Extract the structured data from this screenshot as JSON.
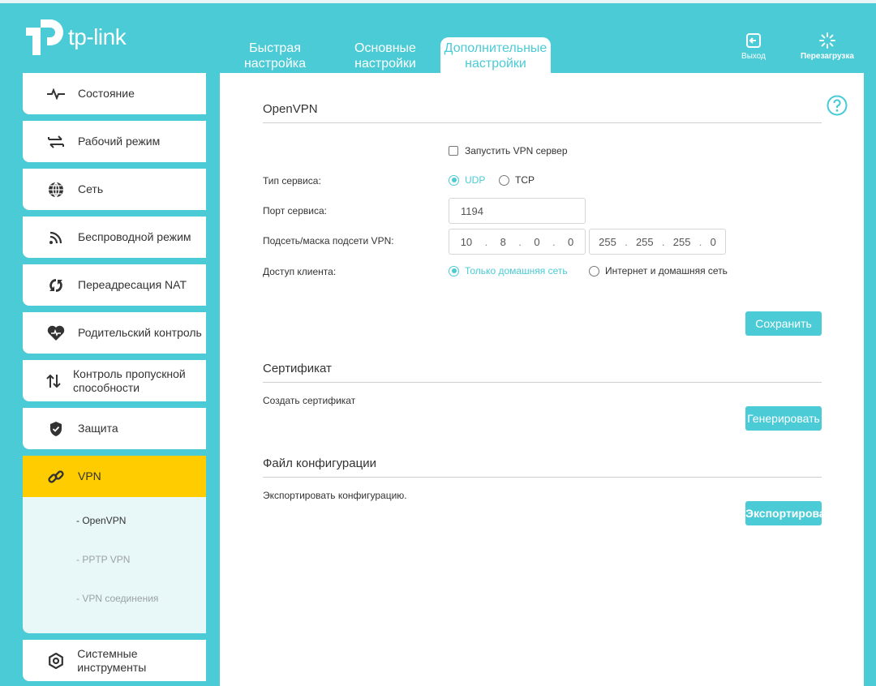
{
  "brand": {
    "logo_text": "tp-link",
    "accent_color": "#4acbd6",
    "active_color": "#ffcc00"
  },
  "header": {
    "tabs": [
      {
        "line1": "Быстрая",
        "line2": "настройка",
        "active": false
      },
      {
        "line1": "Основные",
        "line2": "настройки",
        "active": false
      },
      {
        "line1": "Дополнительные",
        "line2": "настройки",
        "active": true
      }
    ],
    "logout_label": "Выход",
    "reboot_label": "Перезагрузка"
  },
  "sidebar": {
    "items": [
      {
        "label": "Состояние",
        "icon": "pulse-icon"
      },
      {
        "label": "Рабочий режим",
        "icon": "swap-icon"
      },
      {
        "label": "Сеть",
        "icon": "globe-icon"
      },
      {
        "label": "Беспроводной режим",
        "icon": "wifi-icon"
      },
      {
        "label": "Переадресация NAT",
        "icon": "nat-icon"
      },
      {
        "label": "Родительский контроль",
        "icon": "heart-icon"
      },
      {
        "label": "Контроль пропускной способности",
        "icon": "updown-arrows-icon"
      },
      {
        "label": "Защита",
        "icon": "shield-icon"
      },
      {
        "label": "VPN",
        "icon": "link-icon",
        "active": true
      },
      {
        "label": "Системные инструменты",
        "icon": "gear-icon"
      }
    ],
    "vpn_submenu": [
      "- OpenVPN",
      "- PPTP VPN",
      "- VPN соединения"
    ]
  },
  "openvpn": {
    "title": "OpenVPN",
    "enable_label": "Запустить VPN сервер",
    "service_type_label": "Тип сервиса:",
    "udp_label": "UDP",
    "tcp_label": "TCP",
    "port_label": "Порт сервиса:",
    "port_value": "1194",
    "subnet_label": "Подсеть/маска подсети VPN:",
    "subnet": [
      "10",
      "8",
      "0",
      "0"
    ],
    "mask": [
      "255",
      "255",
      "255",
      "0"
    ],
    "access_label": "Доступ клиента:",
    "access_home": "Только домашняя сеть",
    "access_internet": "Интернет и домашняя сеть",
    "save_label": "Сохранить"
  },
  "certificate": {
    "title": "Сертификат",
    "create_label": "Создать сертификат",
    "generate_label": "Генерировать"
  },
  "config_file": {
    "title": "Файл конфигурации",
    "export_text": "Экспортировать конфигурацию.",
    "export_label": "Экспортировать"
  }
}
